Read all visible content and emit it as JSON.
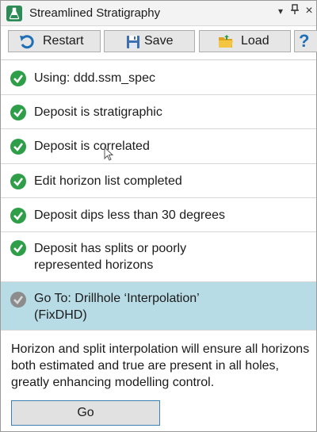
{
  "window": {
    "title": "Streamlined Stratigraphy",
    "controls": {
      "dropdown": "▾",
      "pin": "⊥",
      "close": "×"
    }
  },
  "toolbar": {
    "restart_label": "Restart",
    "save_label": "Save",
    "load_label": "Load",
    "help_label": "?"
  },
  "steps": [
    {
      "label": "Using: ddd.ssm_spec",
      "status": "done"
    },
    {
      "label": "Deposit is stratigraphic",
      "status": "done"
    },
    {
      "label": "Deposit is correlated",
      "status": "done"
    },
    {
      "label": "Edit horizon list completed",
      "status": "done"
    },
    {
      "label": "Deposit dips less than 30 degrees",
      "status": "done"
    },
    {
      "label_line1": "Deposit has splits or poorly",
      "label_line2": "represented horizons",
      "status": "done"
    },
    {
      "label_line1": "Go To: Drillhole ‘Interpolation’",
      "label_line2": "(FixDHD)",
      "status": "current"
    }
  ],
  "description": "Horizon and split interpolation will ensure all horizons both estimated and true are present in all holes, greatly enhancing modelling control.",
  "go_label": "Go",
  "colors": {
    "check_done": "#2e9e48",
    "check_current": "#8c8c8c",
    "active_row": "#b8dce6",
    "accent_border": "#3c7fb1"
  },
  "icons": {
    "app": "flask-icon",
    "restart": "restart-icon",
    "save": "save-icon",
    "load": "folder-icon",
    "done": "check-circle-icon"
  }
}
